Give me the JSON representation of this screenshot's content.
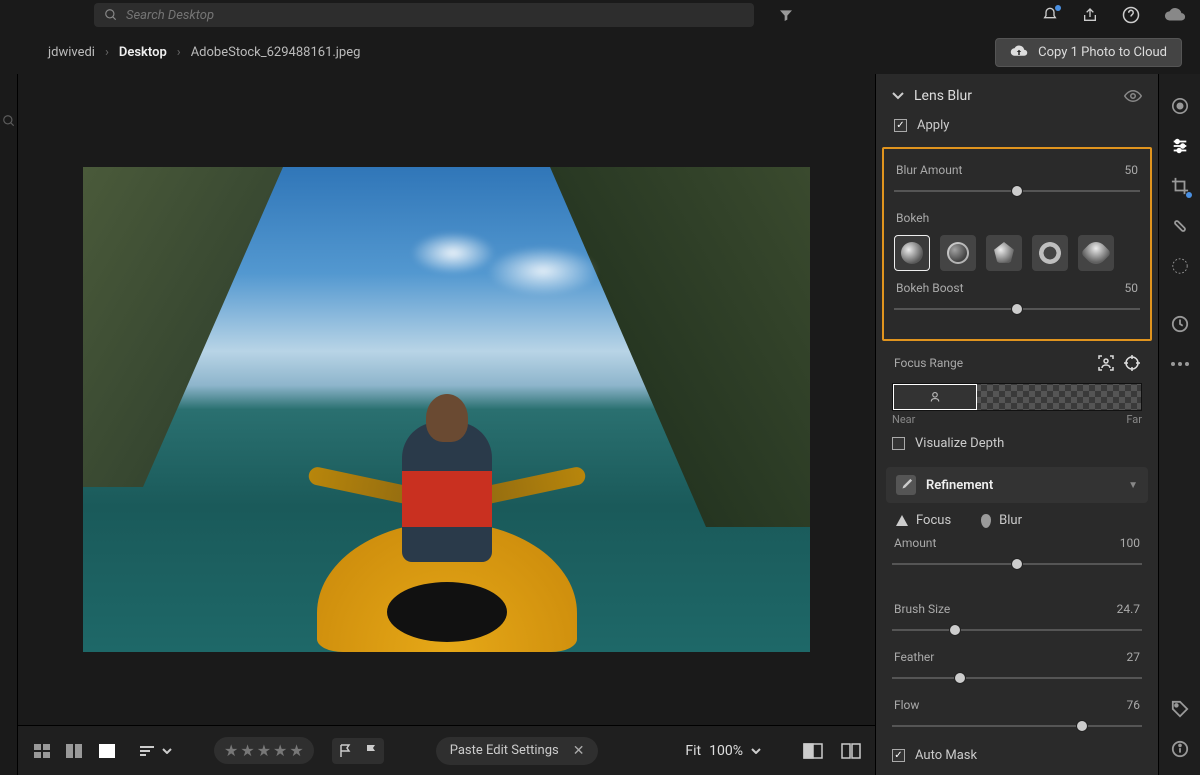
{
  "search": {
    "placeholder": "Search Desktop"
  },
  "breadcrumbs": {
    "root": "jdwivedi",
    "folder": "Desktop",
    "file": "AdobeStock_629488161.jpeg"
  },
  "cloudButton": "Copy 1 Photo to Cloud",
  "panel": {
    "title": "Lens Blur",
    "applyLabel": "Apply",
    "blurAmount": {
      "label": "Blur Amount",
      "value": 50
    },
    "bokehLabel": "Bokeh",
    "bokehBoost": {
      "label": "Bokeh Boost",
      "value": 50
    },
    "focusRangeLabel": "Focus Range",
    "nearLabel": "Near",
    "farLabel": "Far",
    "visualizeDepthLabel": "Visualize Depth",
    "refinementLabel": "Refinement",
    "focusLabel": "Focus",
    "blurLabel": "Blur",
    "amount": {
      "label": "Amount",
      "value": 100
    },
    "brushSize": {
      "label": "Brush Size",
      "value": "24.7"
    },
    "feather": {
      "label": "Feather",
      "value": 27
    },
    "flow": {
      "label": "Flow",
      "value": 76
    },
    "autoMaskLabel": "Auto Mask"
  },
  "bottom": {
    "pasteLabel": "Paste Edit Settings",
    "fitLabel": "Fit",
    "zoom": "100%"
  }
}
